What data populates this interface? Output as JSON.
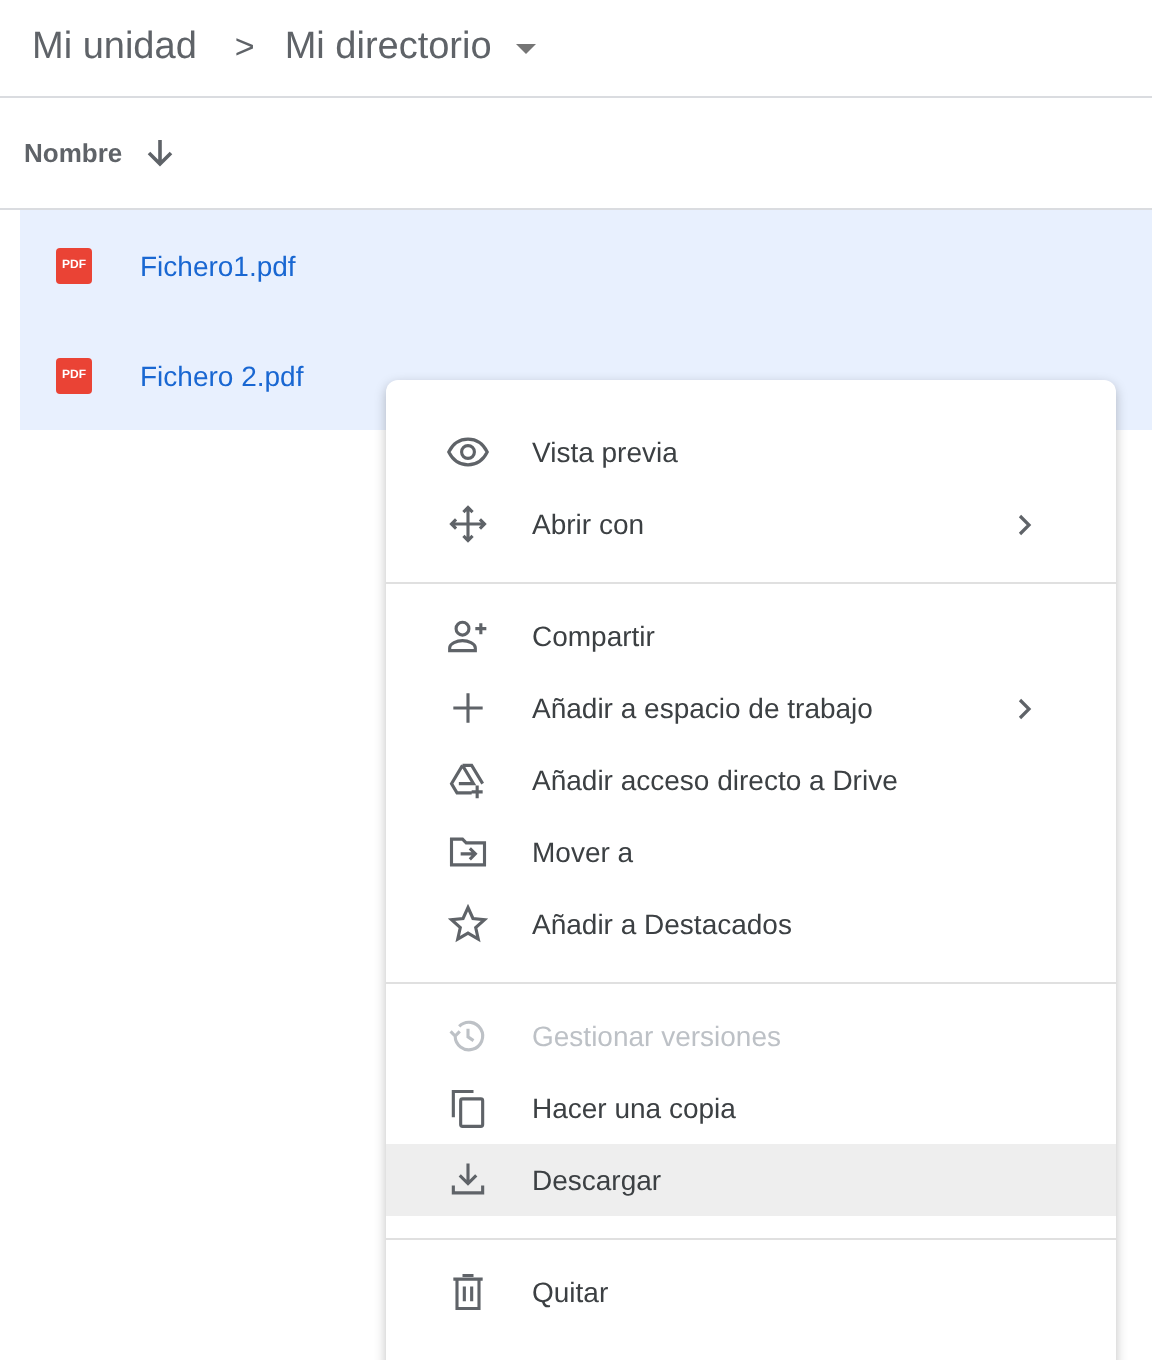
{
  "breadcrumb": {
    "root": "Mi unidad",
    "separator": ">",
    "current": "Mi directorio"
  },
  "list": {
    "column_header": "Nombre",
    "files": [
      {
        "badge": "PDF",
        "name": "Fichero1.pdf",
        "selected": true
      },
      {
        "badge": "PDF",
        "name": "Fichero 2.pdf",
        "selected": true
      }
    ]
  },
  "context_menu": {
    "groups": [
      {
        "items": [
          {
            "label": "Vista previa",
            "disabled": false,
            "highlighted": false,
            "submenu": false
          },
          {
            "label": "Abrir con",
            "disabled": false,
            "highlighted": false,
            "submenu": true
          }
        ]
      },
      {
        "items": [
          {
            "label": "Compartir",
            "disabled": false,
            "highlighted": false,
            "submenu": false
          },
          {
            "label": "Añadir a espacio de trabajo",
            "disabled": false,
            "highlighted": false,
            "submenu": true
          },
          {
            "label": "Añadir acceso directo a Drive",
            "disabled": false,
            "highlighted": false,
            "submenu": false
          },
          {
            "label": "Mover a",
            "disabled": false,
            "highlighted": false,
            "submenu": false
          },
          {
            "label": "Añadir a Destacados",
            "disabled": false,
            "highlighted": false,
            "submenu": false
          }
        ]
      },
      {
        "items": [
          {
            "label": "Gestionar versiones",
            "disabled": true,
            "highlighted": false,
            "submenu": false
          },
          {
            "label": "Hacer una copia",
            "disabled": false,
            "highlighted": false,
            "submenu": false
          },
          {
            "label": "Descargar",
            "disabled": false,
            "highlighted": true,
            "submenu": false
          }
        ]
      },
      {
        "items": [
          {
            "label": "Quitar",
            "disabled": false,
            "highlighted": false,
            "submenu": false
          }
        ]
      }
    ]
  }
}
